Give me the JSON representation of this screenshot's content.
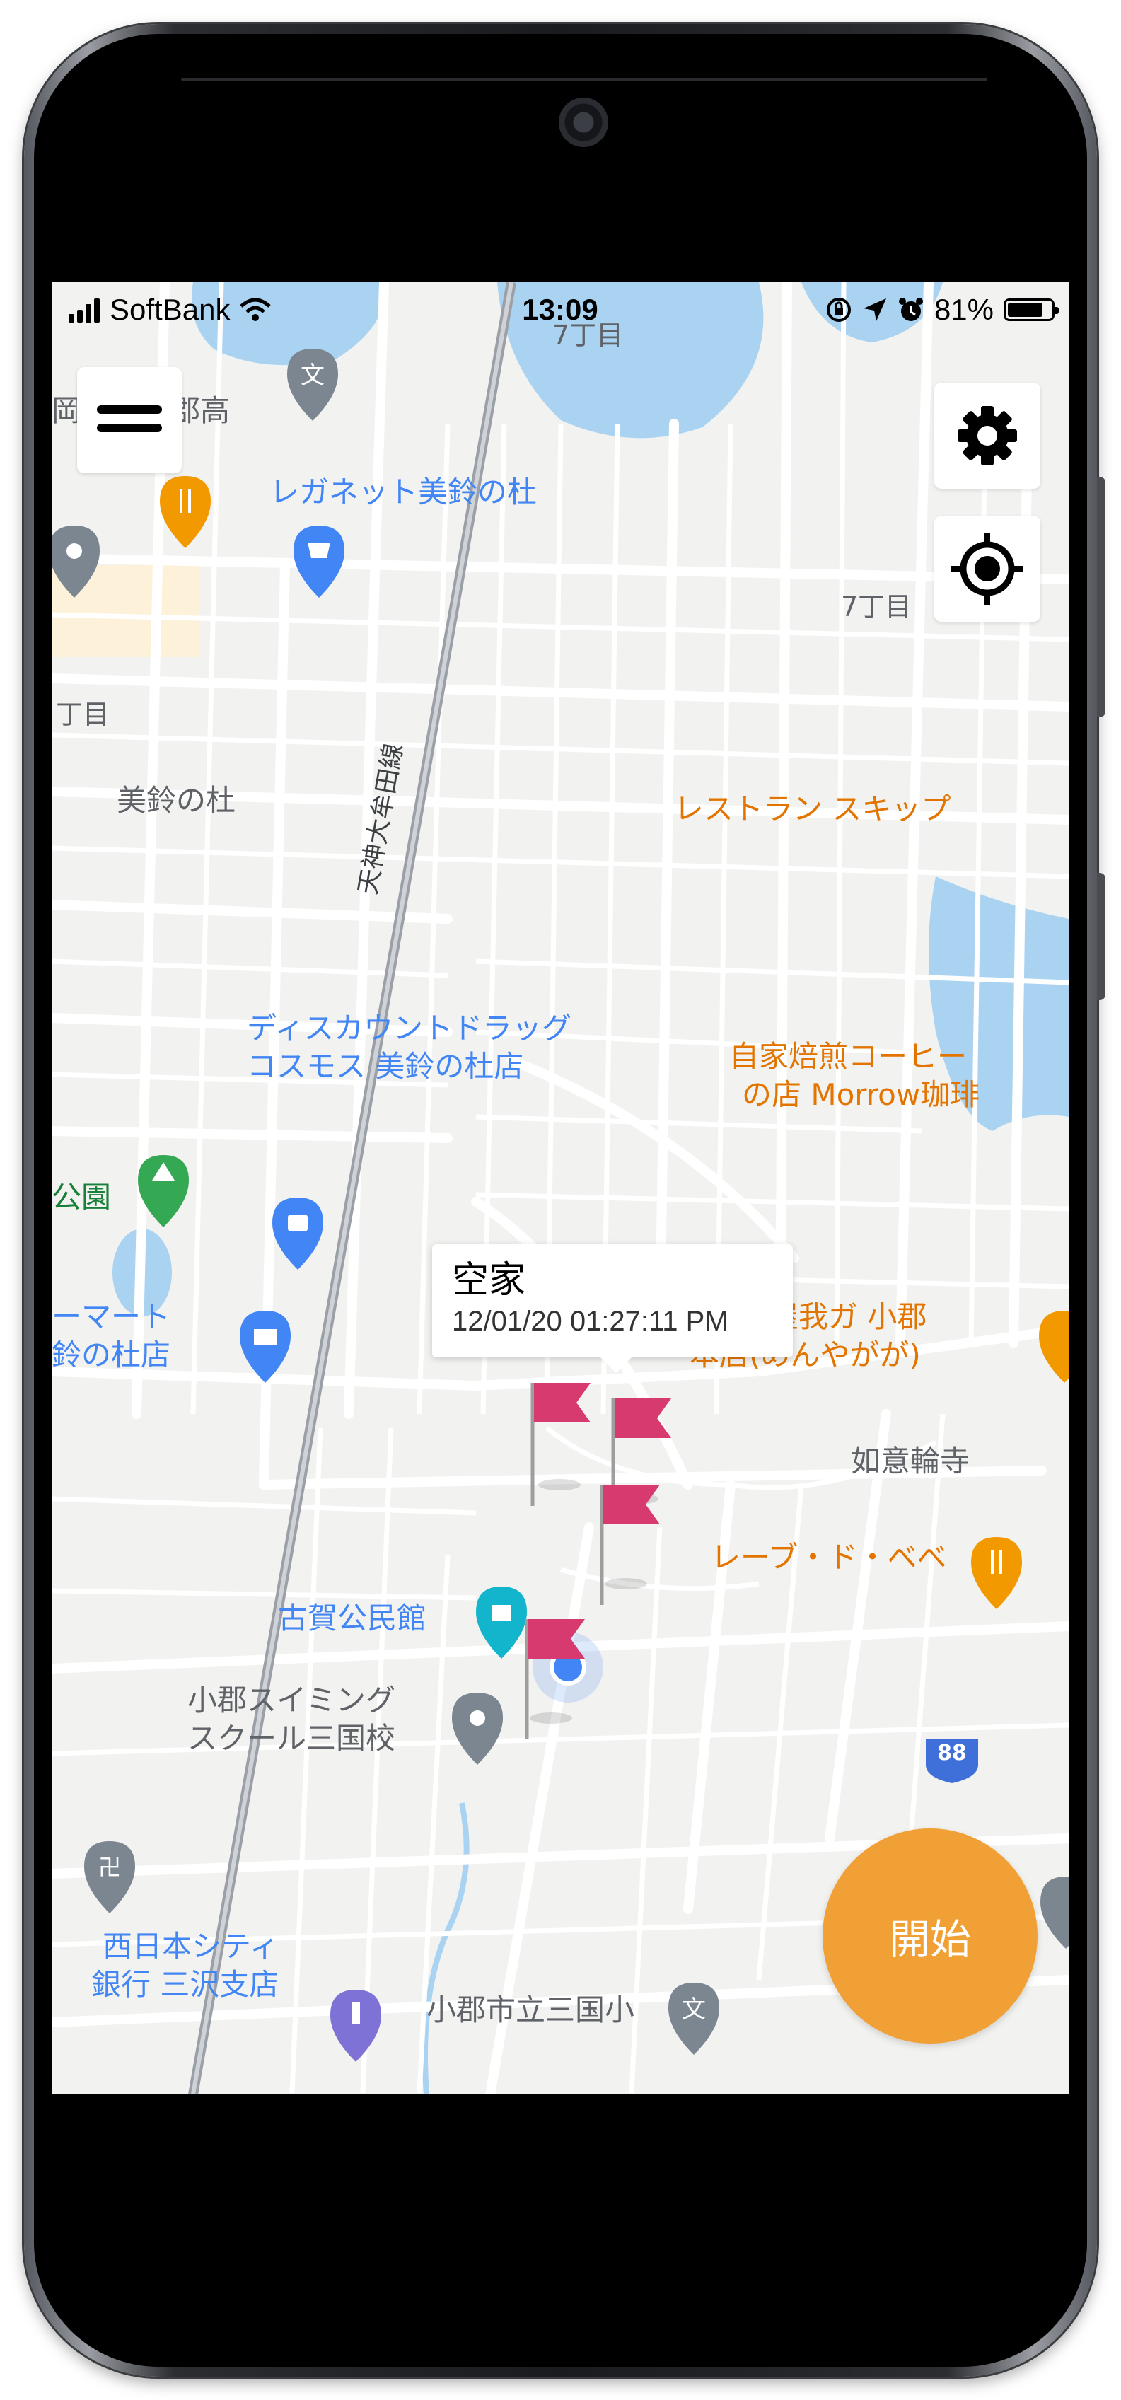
{
  "status_bar": {
    "carrier": "SoftBank",
    "time": "13:09",
    "battery": "81%",
    "battery_level": 0.81
  },
  "map": {
    "labels": {
      "rail_line": "天神大牟田線",
      "district_7chome_top": "7丁目",
      "district_7chome_right": "7丁目",
      "district_chome_left": "丁目",
      "misuzu_no_mori": "美鈴の杜",
      "school_top": "郡高",
      "school_top_prefix": "岡!",
      "leganet": "レガネット美鈴の杜",
      "restaurant_skip": "レストラン スキップ",
      "cosmos_line1": "ディスカウントドラッグ",
      "cosmos_line2": "コスモス 美鈴の杜店",
      "coffee_line1": "自家焙煎コーヒー",
      "coffee_line2": "の店 Morrow珈琲",
      "park": "公園",
      "familymart_line1": "ーマート",
      "familymart_line2": "鈴の杜店",
      "ramen_line1": "麺屋我ガ 小郡",
      "ramen_line2": "本店(めんやがが)",
      "nyoirinji": "如意輪寺",
      "reve": "レーブ・ド・べべ",
      "koga_hall": "古賀公民館",
      "swim_line1": "小郡スイミング",
      "swim_line2": "スクール三国校",
      "route_number": "88",
      "bank_line1": "西日本シティ",
      "bank_line2": "銀行 三沢支店",
      "mikuni_school": "小郡市立三国小"
    }
  },
  "callout": {
    "title": "空家",
    "timestamp": "12/01/20 01:27:11 PM"
  },
  "controls": {
    "menu_icon": "hamburger-icon",
    "settings_icon": "gear-icon",
    "locate_icon": "crosshair-location-icon",
    "start_label": "開始"
  },
  "colors": {
    "start_button": "#f0a035",
    "flag": "#d63a6f",
    "user_location": "#4285f4",
    "water": "#aad3f2",
    "poi_orange": "#f29900",
    "poi_blue": "#4285f4",
    "poi_green": "#34a853",
    "poi_gray": "#7c8690"
  }
}
